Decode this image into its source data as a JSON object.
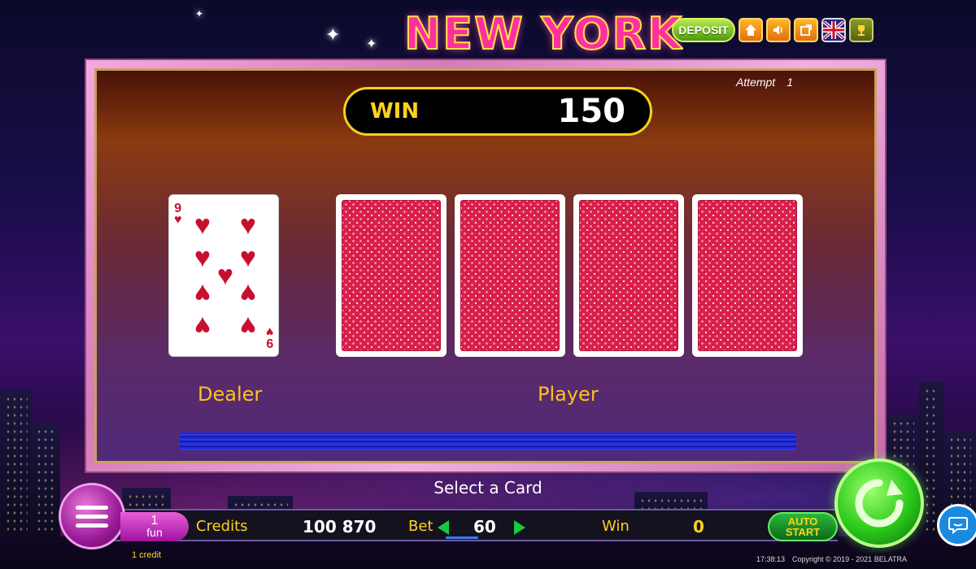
{
  "header": {
    "title": "NEW YORK",
    "deposit_label": "DEPOSIT",
    "icons": [
      "home-icon",
      "sound-icon",
      "fullscreen-icon",
      "uk-flag-icon",
      "trophy-icon"
    ]
  },
  "board": {
    "attempt_label": "Attempt",
    "attempt_value": "1",
    "win_label": "WIN",
    "win_value": "150",
    "dealer_label": "Dealer",
    "player_label": "Player",
    "dealer_card": {
      "rank": "9",
      "suit": "hearts",
      "suit_symbol": "♥"
    },
    "player_cards": [
      "face-down",
      "face-down",
      "face-down",
      "face-down"
    ]
  },
  "prompt": "Select a Card",
  "bottom_bar": {
    "fun_value": "1",
    "fun_unit": "fun",
    "credit_note": "1 credit",
    "credits_label": "Credits",
    "credits_value": "100 870",
    "bet_label": "Bet",
    "bet_value": "60",
    "win_label": "Win",
    "win_value": "0",
    "auto_label_1": "AUTO",
    "auto_label_2": "START"
  },
  "footer": {
    "time": "17:38:13",
    "copyright": "Copyright © 2019 - 2021 BELATRA"
  },
  "colors": {
    "accent_yellow": "#ffd21a",
    "card_red": "#c8102e",
    "spin_green": "#2ac81a"
  }
}
